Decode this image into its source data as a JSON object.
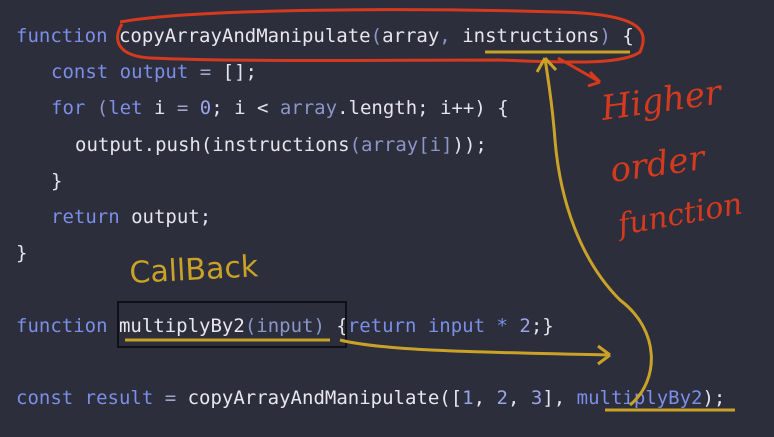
{
  "code": {
    "line1": {
      "kw": "function",
      "name": "copyArrayAndManipulate",
      "open": "(",
      "p1": "array",
      "comma": ", ",
      "p2": "instructions",
      "close": ")",
      "brace": " {"
    },
    "line2": {
      "kw": "const",
      "var": "output",
      "eq": " = ",
      "val": "[];"
    },
    "line3": {
      "kw": "for",
      "open": " (",
      "let": "let",
      "var": " i",
      "eq": " = ",
      "zero": "0",
      "semi1": "; i < ",
      "arr": "array",
      "len": ".length; i++) {"
    },
    "line4": {
      "text1": "output.push(",
      "fn": "instructions",
      "open": "(",
      "arr": "array[i]",
      "close": "));"
    },
    "line5": {
      "text": "}"
    },
    "line6": {
      "kw": "return",
      "var": " output;"
    },
    "line7": {
      "text": "}"
    },
    "line9": {
      "kw": "function",
      "name": "multiplyBy2",
      "params": "(input)",
      "body1": " {",
      "ret": "return",
      "body2": " input * ",
      "two": "2",
      "body3": ";}"
    },
    "line11": {
      "kw": "const",
      "var": " result",
      "eq": " = ",
      "call": "copyArrayAndManipulate",
      "open": "([",
      "n1": "1",
      "c1": ", ",
      "n2": "2",
      "c2": ", ",
      "n3": "3",
      "c3": "], ",
      "arg": "multiplyBy2",
      "close": ");"
    }
  },
  "annotations": {
    "higher_order_1": "Higher",
    "higher_order_2": "order",
    "higher_order_3": "function",
    "callback": "CallBack"
  },
  "colors": {
    "background": "#2c2e3b",
    "keyword": "#7b8ee8",
    "red_ink": "#d63a1e",
    "yellow_ink": "#c9a227"
  }
}
